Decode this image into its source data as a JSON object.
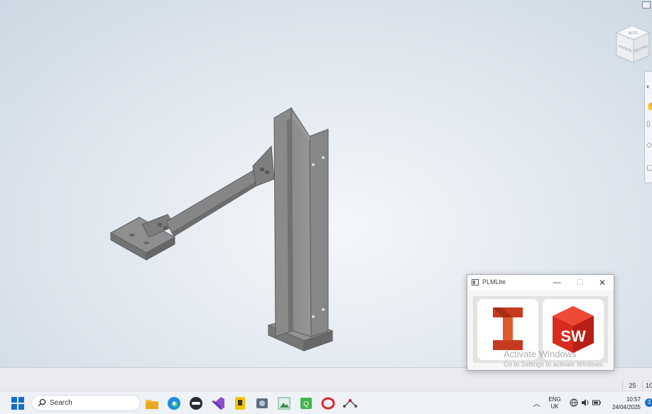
{
  "viewcube": {
    "face_top": "ALTO",
    "face_left": "FRONTE",
    "face_right": "DESTRA"
  },
  "statusbar": {
    "field_a": "25",
    "field_b": "10"
  },
  "plm_window": {
    "title": "PLMLite",
    "minimize_glyph": "—",
    "maximize_glyph": "☐",
    "close_glyph": "✕",
    "tiles": [
      {
        "app": "Autodesk Inventor",
        "glyph": "I",
        "color": "#c63b1f"
      },
      {
        "app": "SolidWorks",
        "glyph": "SW",
        "color": "#d72b20"
      }
    ]
  },
  "watermark": {
    "title": "Activate Windows",
    "subtitle": "Go to Settings to activate Windows."
  },
  "taskbar": {
    "search_placeholder": "Search",
    "lang_line1": "ENG",
    "lang_line2": "UK",
    "time": "10:57",
    "date": "24/04/2025",
    "notification_count": "3",
    "apps": [
      "file-explorer",
      "edge",
      "media-app",
      "visual-studio",
      "slack-like",
      "control-panel",
      "image-editor",
      "qt-app",
      "opera",
      "network-app"
    ]
  },
  "colors": {
    "accent_blue": "#1670c9",
    "model_gray": "#8e8e8e",
    "inventor_red": "#c63b1f",
    "solidworks_red": "#d72b20"
  }
}
